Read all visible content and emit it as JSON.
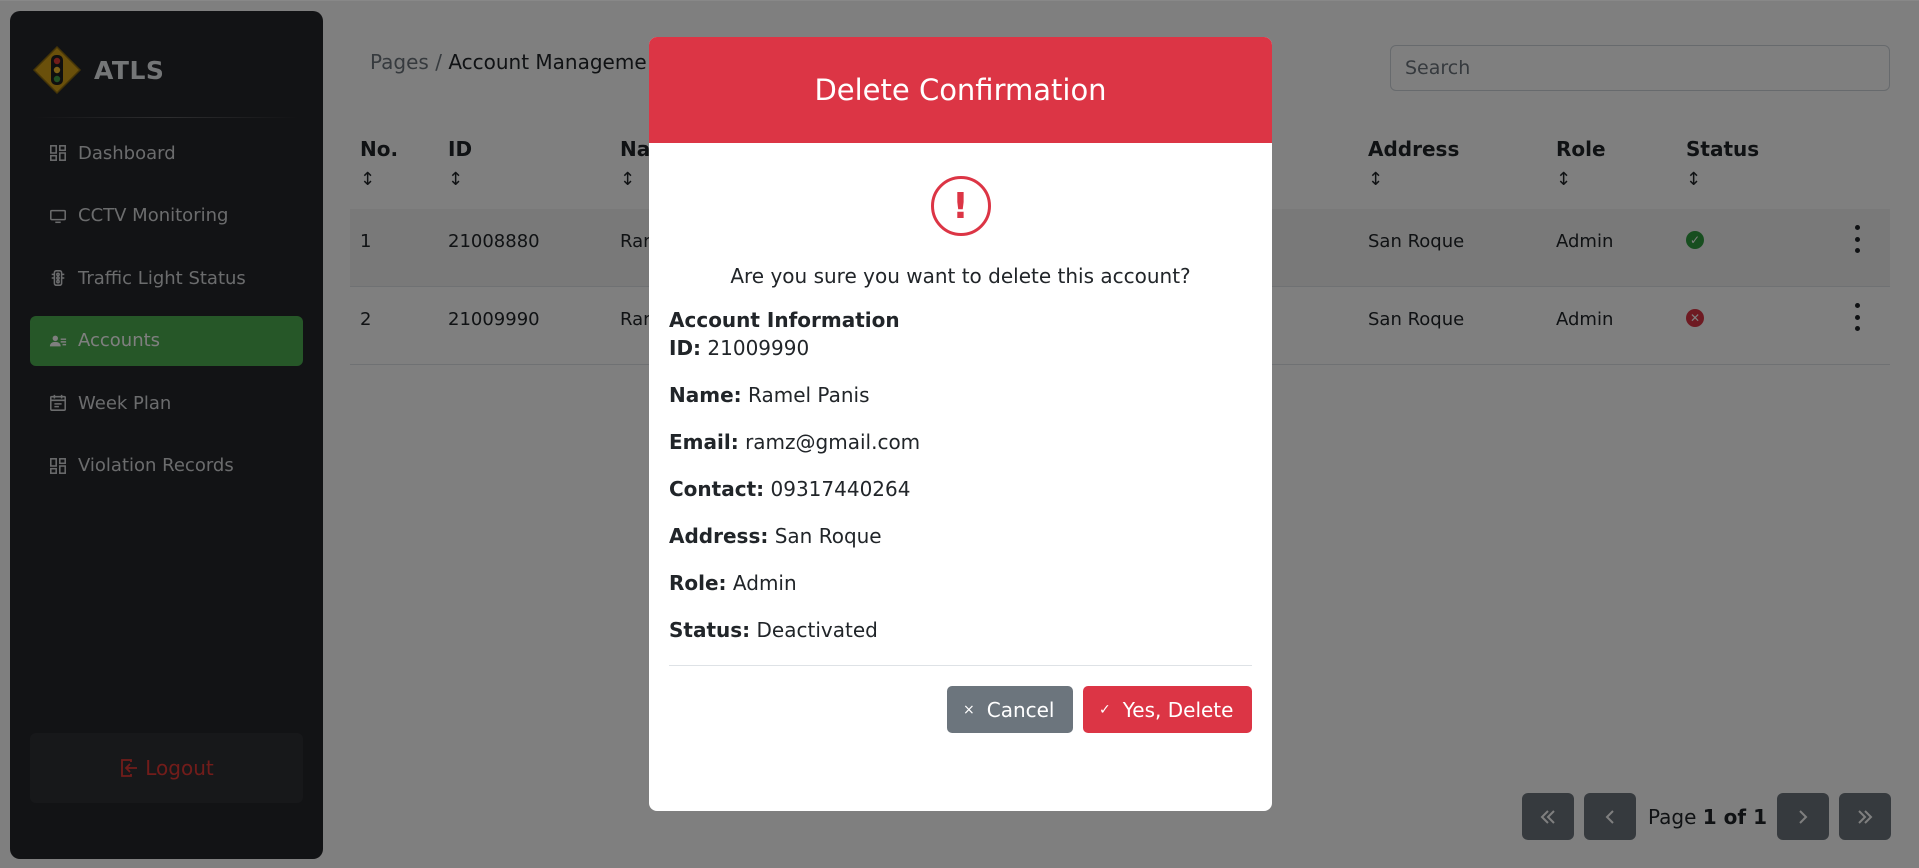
{
  "sidebar": {
    "brand": "ATLS",
    "items": [
      {
        "label": "Dashboard",
        "icon": "dashboard-icon",
        "active": false
      },
      {
        "label": "CCTV Monitoring",
        "icon": "monitor-icon",
        "active": false
      },
      {
        "label": "Traffic Light Status",
        "icon": "traffic-light-icon",
        "active": false
      },
      {
        "label": "Accounts",
        "icon": "users-icon",
        "active": true
      },
      {
        "label": "Week Plan",
        "icon": "calendar-icon",
        "active": false
      },
      {
        "label": "Violation Records",
        "icon": "grid-icon",
        "active": false
      }
    ],
    "logout": "Logout"
  },
  "header": {
    "breadcrumb_root": "Pages",
    "breadcrumb_sep": "/",
    "breadcrumb_current": "Account Manageme",
    "search_placeholder": "Search"
  },
  "table": {
    "columns": [
      "No.",
      "ID",
      "Na",
      "Address",
      "Role",
      "Status"
    ],
    "sort_glyph": "↕",
    "rows": [
      {
        "no": "1",
        "id": "21008880",
        "name": "Ran",
        "address": "San Roque",
        "role": "Admin",
        "status": "active"
      },
      {
        "no": "2",
        "id": "21009990",
        "name": "Ran",
        "address": "San Roque",
        "role": "Admin",
        "status": "deactivated"
      }
    ]
  },
  "pagination": {
    "page_label": "Page",
    "page_value": "1 of 1"
  },
  "modal": {
    "title": "Delete Confirmation",
    "icon_glyph": "!",
    "question": "Are you sure you want to delete this account?",
    "info_title": "Account Information",
    "fields": [
      {
        "label": "ID:",
        "value": "21009990"
      },
      {
        "label": "Name:",
        "value": "Ramel Panis"
      },
      {
        "label": "Email:",
        "value": "ramz@gmail.com"
      },
      {
        "label": "Contact:",
        "value": "09317440264"
      },
      {
        "label": "Address:",
        "value": "San Roque"
      },
      {
        "label": "Role:",
        "value": "Admin"
      },
      {
        "label": "Status:",
        "value": "Deactivated"
      }
    ],
    "cancel_icon": "×",
    "cancel_label": "Cancel",
    "delete_icon": "✓",
    "delete_label": "Yes, Delete"
  },
  "colors": {
    "accent_green": "#4caf50",
    "danger_red": "#dc3545",
    "secondary_gray": "#6c757d",
    "sidebar_bg": "#25262a"
  }
}
